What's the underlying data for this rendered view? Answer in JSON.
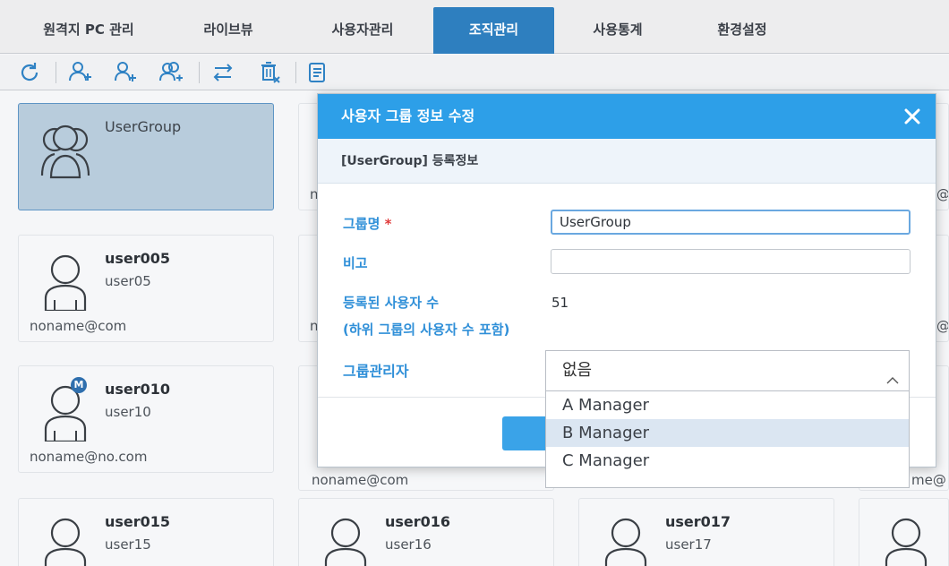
{
  "nav": {
    "tabs": [
      {
        "label": "원격지 PC 관리"
      },
      {
        "label": "라이브뷰"
      },
      {
        "label": "사용자관리"
      },
      {
        "label": "조직관리"
      },
      {
        "label": "사용통계"
      },
      {
        "label": "환경설정"
      }
    ],
    "active_tab": "조직관리"
  },
  "toolbar": {
    "icons": [
      "refresh-icon",
      "add-group-icon",
      "add-user-icon",
      "add-multi-user-icon",
      "move-icon",
      "delete-icon",
      "list-icon"
    ]
  },
  "cards": {
    "group": {
      "name": "UserGroup"
    },
    "user005": {
      "name": "user005",
      "sub": "user05",
      "mail": "noname@com"
    },
    "user010": {
      "name": "user010",
      "sub": "user10",
      "mail": "noname@no.com",
      "badge": "M"
    },
    "user015": {
      "name": "user015",
      "sub": "user15"
    },
    "user016": {
      "name": "user016",
      "sub": "user16"
    },
    "user017": {
      "name": "user017",
      "sub": "user17"
    },
    "hidden_mail_mid": "noname@com",
    "frag_r1": "n",
    "frag_r2": "n",
    "frag_right1": "@",
    "frag_right2": "@",
    "frag_right3": "me@"
  },
  "modal": {
    "title": "사용자 그룹 정보 수정",
    "subtitle": "[UserGroup] 등록정보",
    "group_name_label": "그룹명",
    "required_mark": "*",
    "group_name_value": "UserGroup",
    "note_label": "비고",
    "note_value": "",
    "user_count_label": "등록된 사용자 수",
    "user_count_sublabel": "(하위 그룹의 사용자 수 포함)",
    "user_count_value": "51",
    "manager_label": "그룹관리자",
    "manager_selected": "없음",
    "manager_options": [
      "A Manager",
      "B Manager",
      "C Manager"
    ],
    "highlighted_option": "B Manager"
  },
  "colors": {
    "accent": "#2d9fe8",
    "active_tab": "#2e7fbf",
    "label_blue": "#2f8fd8",
    "required_red": "#e03a3a"
  }
}
